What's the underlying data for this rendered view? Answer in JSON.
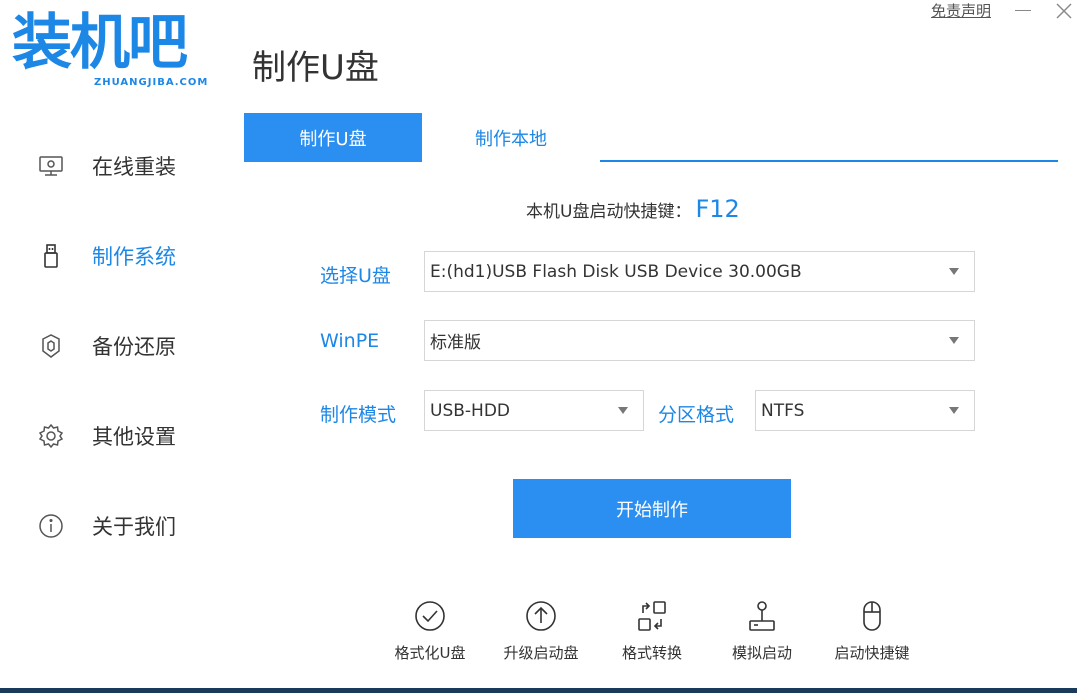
{
  "window": {
    "disclaimer": "免责声明"
  },
  "logo": {
    "text": "装机吧",
    "subtext": "ZHUANGJIBA.COM"
  },
  "page_title": "制作U盘",
  "sidebar": {
    "items": [
      {
        "label": "在线重装",
        "icon": "monitor-icon",
        "active": false
      },
      {
        "label": "制作系统",
        "icon": "usb-icon",
        "active": true
      },
      {
        "label": "备份还原",
        "icon": "backup-icon",
        "active": false
      },
      {
        "label": "其他设置",
        "icon": "gear-icon",
        "active": false
      },
      {
        "label": "关于我们",
        "icon": "info-icon",
        "active": false
      }
    ]
  },
  "tabs": [
    {
      "label": "制作U盘",
      "active": true
    },
    {
      "label": "制作本地",
      "active": false
    }
  ],
  "hotkey": {
    "label": "本机U盘启动快捷键：",
    "key": "F12"
  },
  "form": {
    "usb_label": "选择U盘",
    "usb_value": "E:(hd1)USB Flash Disk USB Device 30.00GB",
    "winpe_label": "WinPE",
    "winpe_value": "标准版",
    "mode_label": "制作模式",
    "mode_value": "USB-HDD",
    "partition_label": "分区格式",
    "partition_value": "NTFS"
  },
  "start_button": "开始制作",
  "tools": [
    {
      "label": "格式化U盘",
      "icon": "check-circle-icon"
    },
    {
      "label": "升级启动盘",
      "icon": "upload-circle-icon"
    },
    {
      "label": "格式转换",
      "icon": "convert-icon"
    },
    {
      "label": "模拟启动",
      "icon": "joystick-icon"
    },
    {
      "label": "启动快捷键",
      "icon": "mouse-icon"
    }
  ],
  "colors": {
    "accent": "#1d87e6",
    "button": "#2a8ff0"
  }
}
